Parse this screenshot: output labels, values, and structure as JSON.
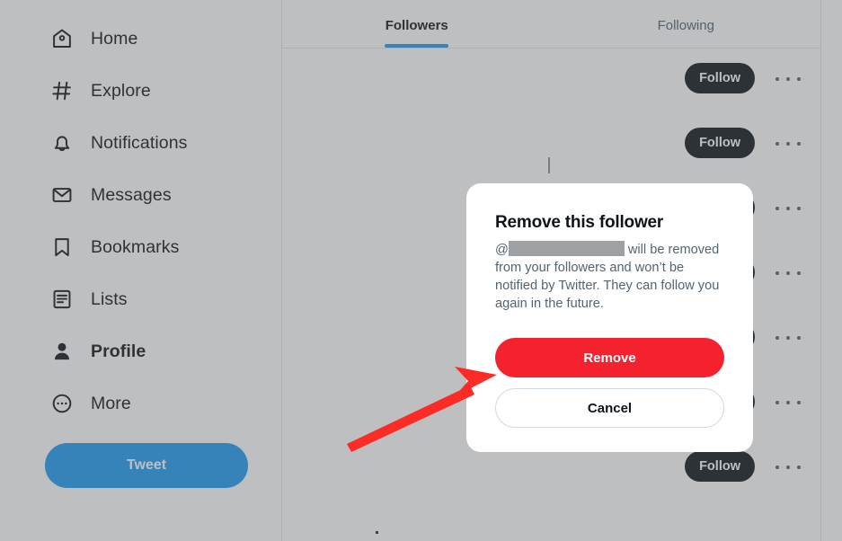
{
  "sidebar": {
    "items": [
      {
        "label": "Home",
        "icon": "home-icon",
        "active": false
      },
      {
        "label": "Explore",
        "icon": "hash-icon",
        "active": false
      },
      {
        "label": "Notifications",
        "icon": "bell-icon",
        "active": false
      },
      {
        "label": "Messages",
        "icon": "envelope-icon",
        "active": false
      },
      {
        "label": "Bookmarks",
        "icon": "bookmark-icon",
        "active": false
      },
      {
        "label": "Lists",
        "icon": "list-icon",
        "active": false
      },
      {
        "label": "Profile",
        "icon": "person-icon",
        "active": true
      },
      {
        "label": "More",
        "icon": "more-circle-icon",
        "active": false
      }
    ],
    "tweet_button": "Tweet"
  },
  "main": {
    "tabs": [
      {
        "label": "Followers",
        "active": true
      },
      {
        "label": "Following",
        "active": false
      }
    ],
    "rows": [
      {
        "follow_label": "Follow",
        "more_label": "More"
      },
      {
        "follow_label": "Follow",
        "more_label": "More"
      },
      {
        "follow_label": "Follow",
        "more_label": "More"
      },
      {
        "follow_label": "Follow",
        "more_label": "More"
      },
      {
        "follow_label": "Follow",
        "more_label": "More"
      },
      {
        "follow_label": "Follow",
        "more_label": "More"
      },
      {
        "follow_label": "Follow",
        "more_label": "More"
      }
    ]
  },
  "modal": {
    "title": "Remove this follower",
    "body_prefix": "@",
    "body_suffix": " will be removed from your followers and won’t be notified by Twitter. They can follow you again in the future.",
    "remove_label": "Remove",
    "cancel_label": "Cancel"
  },
  "colors": {
    "accent_blue": "#1d9bf0",
    "danger_red": "#f4212e",
    "text_primary": "#0f1419",
    "text_secondary": "#536471",
    "annotation_red": "#fc2b25",
    "scrim": "rgba(91,96,99,0.4)"
  }
}
